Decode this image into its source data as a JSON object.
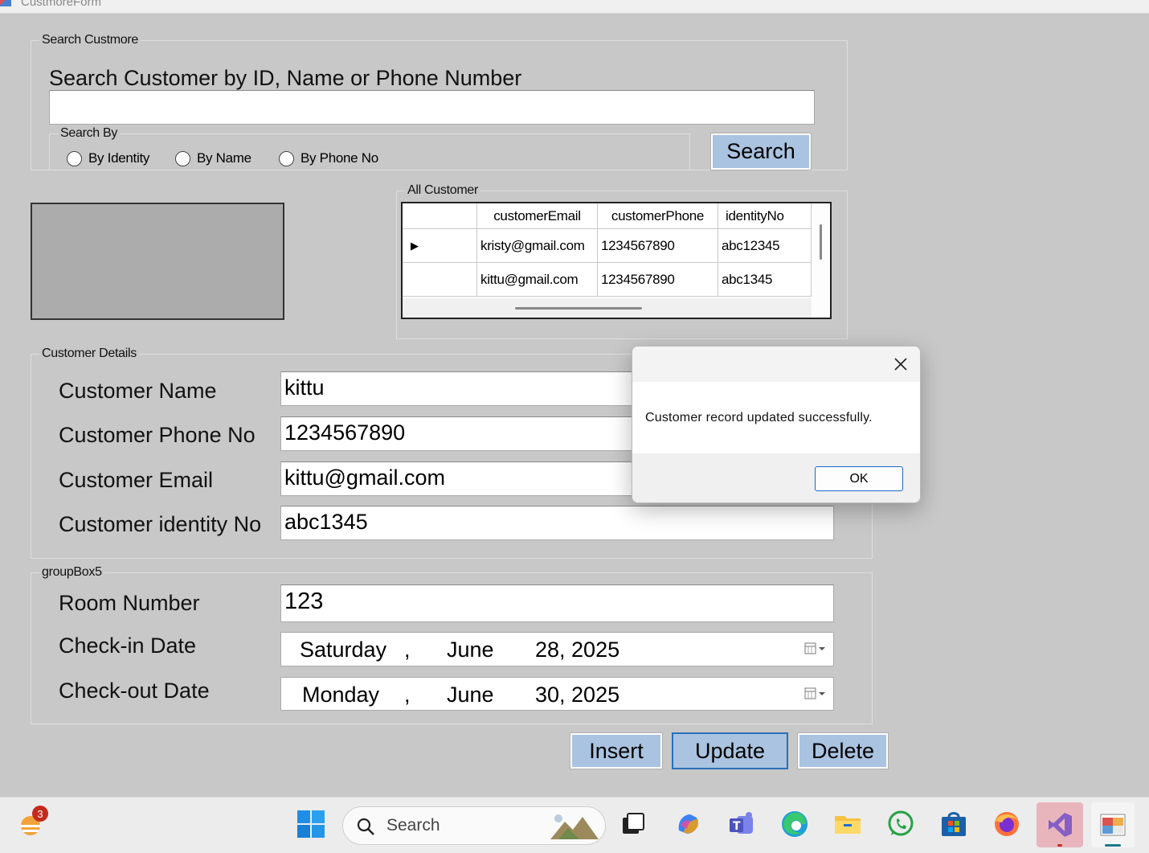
{
  "window": {
    "title": "CustmoreForm"
  },
  "search_group": {
    "legend": "Search Custmore",
    "heading": "Search Customer by ID, Name or Phone Number",
    "search_value": "",
    "search_button": "Search",
    "search_by": {
      "legend": "Search By",
      "options": [
        "By Identity",
        "By Name",
        "By Phone No"
      ]
    }
  },
  "all_customer": {
    "legend": "All Customer",
    "columns": [
      "customerEmail",
      "customerPhone",
      "identityNo"
    ],
    "rows": [
      {
        "email": "kristy@gmail.com",
        "phone": "1234567890",
        "identity": "abc12345"
      },
      {
        "email": "kittu@gmail.com",
        "phone": "1234567890",
        "identity": "abc1345"
      }
    ]
  },
  "customer_details": {
    "legend": "Customer Details",
    "name_label": "Customer Name",
    "name_value": "kittu",
    "phone_label": "Customer Phone No",
    "phone_value": "1234567890",
    "email_label": "Customer Email",
    "email_value": "kittu@gmail.com",
    "identity_label": "Customer identity No",
    "identity_value": "abc1345"
  },
  "booking": {
    "legend": "groupBox5",
    "room_label": "Room Number",
    "room_value": "123",
    "checkin_label": "Check-in Date",
    "checkin": {
      "weekday": "Saturday",
      "month": "June",
      "day_year": "28, 2025"
    },
    "checkout_label": "Check-out Date",
    "checkout": {
      "weekday": "Monday",
      "month": "June",
      "day_year": "30, 2025"
    }
  },
  "actions": {
    "insert": "Insert",
    "update": "Update",
    "delete": "Delete"
  },
  "dialog": {
    "message": "Customer record updated successfully.",
    "ok": "OK"
  },
  "taskbar": {
    "search_placeholder": "Search",
    "weather_badge": "3"
  }
}
